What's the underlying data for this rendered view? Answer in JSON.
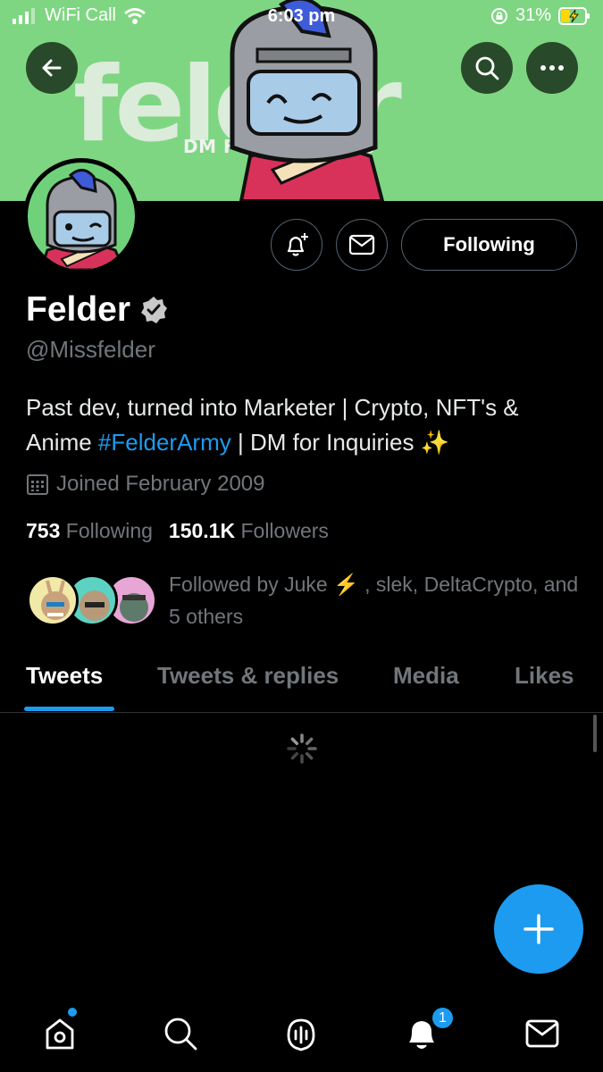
{
  "status_bar": {
    "carrier": "WiFi Call",
    "time": "6:03 pm",
    "battery": "31%"
  },
  "banner": {
    "word": "felder",
    "subtitle": "DM FOR BUSINESS"
  },
  "profile": {
    "display_name": "Felder",
    "handle": "@Missfelder",
    "bio_before": "Past dev, turned into Marketer | Crypto, NFT's & Anime ",
    "bio_hashtag": "#FelderArmy",
    "bio_after": " | DM for Inquiries ✨",
    "joined": "Joined February 2009",
    "following_count": "753",
    "following_label": "Following",
    "followers_count": "150.1K",
    "followers_label": "Followers",
    "followed_by": "Followed by Juke ⚡ , slek, DeltaCrypto, and 5 others"
  },
  "actions": {
    "follow_button": "Following"
  },
  "tabs": [
    {
      "label": "Tweets",
      "active": true
    },
    {
      "label": "Tweets & replies",
      "active": false
    },
    {
      "label": "Media",
      "active": false
    },
    {
      "label": "Likes",
      "active": false
    }
  ],
  "bottom_nav": {
    "notifications_badge": "1"
  },
  "colors": {
    "accent": "#1d9bf0",
    "banner": "#7fd682",
    "muted_text": "#71767b"
  },
  "icons": [
    "back-arrow-icon",
    "search-icon",
    "more-icon",
    "bell-plus-icon",
    "mail-icon",
    "verified-badge-icon",
    "calendar-icon",
    "plus-icon",
    "home-icon",
    "spaces-icon",
    "bell-icon"
  ]
}
